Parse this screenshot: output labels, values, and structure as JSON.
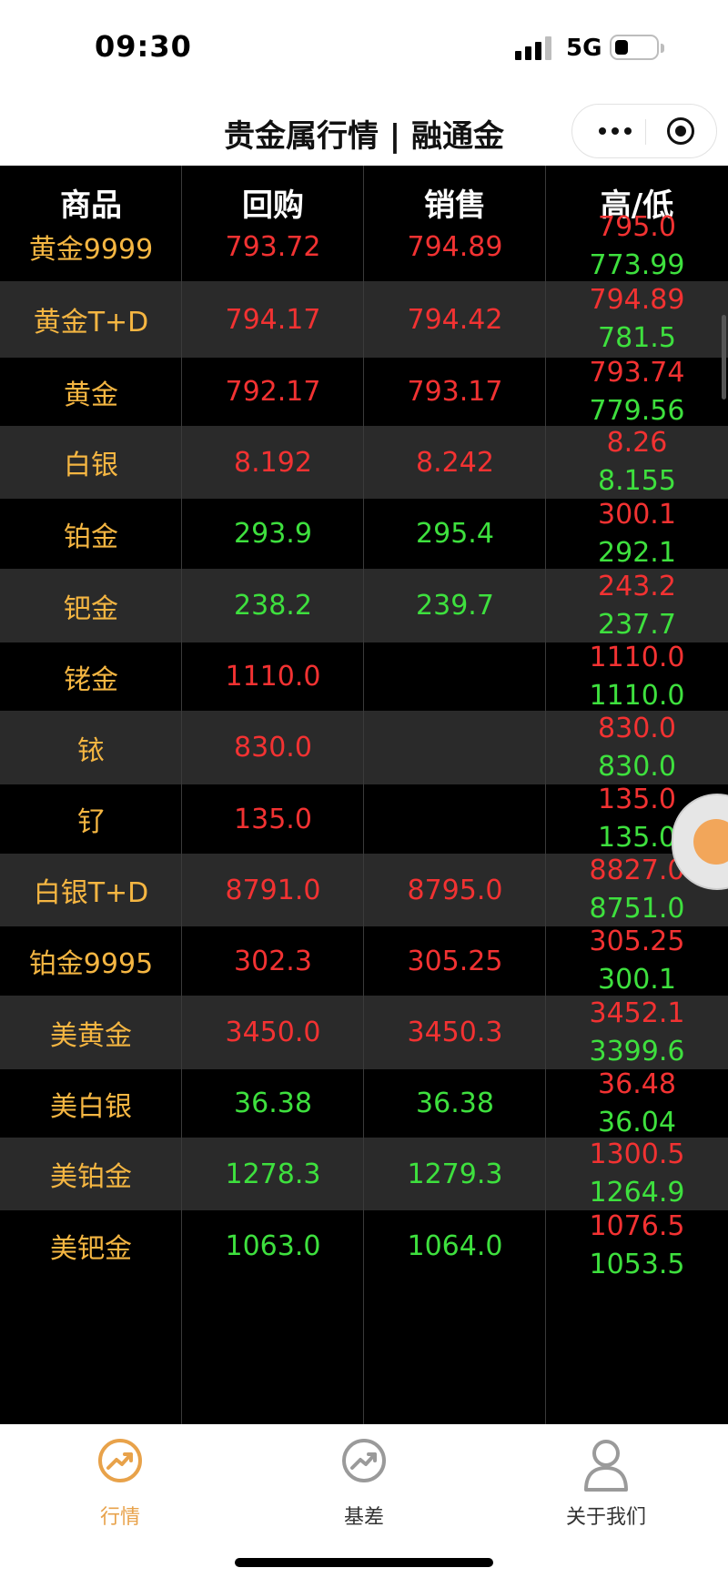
{
  "status_bar": {
    "time": "09:30",
    "network": "5G"
  },
  "nav": {
    "title": "贵金属行情 | 融通金",
    "menu_icon": "more-dots-icon",
    "close_icon": "target-close-icon"
  },
  "table": {
    "headers": [
      "商品",
      "回购",
      "销售",
      "高/低"
    ],
    "rows": [
      {
        "name": "黄金9999",
        "buy": "793.72",
        "buy_color": "red",
        "sell": "794.89",
        "sell_color": "red",
        "high": "795.0",
        "low": "773.99"
      },
      {
        "name": "黄金T+D",
        "buy": "794.17",
        "buy_color": "red",
        "sell": "794.42",
        "sell_color": "red",
        "high": "794.89",
        "low": "781.5"
      },
      {
        "name": "黄金",
        "buy": "792.17",
        "buy_color": "red",
        "sell": "793.17",
        "sell_color": "red",
        "high": "793.74",
        "low": "779.56"
      },
      {
        "name": "白银",
        "buy": "8.192",
        "buy_color": "red",
        "sell": "8.242",
        "sell_color": "red",
        "high": "8.26",
        "low": "8.155"
      },
      {
        "name": "铂金",
        "buy": "293.9",
        "buy_color": "green",
        "sell": "295.4",
        "sell_color": "green",
        "high": "300.1",
        "low": "292.1"
      },
      {
        "name": "钯金",
        "buy": "238.2",
        "buy_color": "green",
        "sell": "239.7",
        "sell_color": "green",
        "high": "243.2",
        "low": "237.7"
      },
      {
        "name": "铑金",
        "buy": "1110.0",
        "buy_color": "red",
        "sell": "",
        "sell_color": "red",
        "high": "1110.0",
        "low": "1110.0"
      },
      {
        "name": "铱",
        "buy": "830.0",
        "buy_color": "red",
        "sell": "",
        "sell_color": "red",
        "high": "830.0",
        "low": "830.0"
      },
      {
        "name": "钌",
        "buy": "135.0",
        "buy_color": "red",
        "sell": "",
        "sell_color": "red",
        "high": "135.0",
        "low": "135.0"
      },
      {
        "name": "白银T+D",
        "buy": "8791.0",
        "buy_color": "red",
        "sell": "8795.0",
        "sell_color": "red",
        "high": "8827.0",
        "low": "8751.0"
      },
      {
        "name": "铂金9995",
        "buy": "302.3",
        "buy_color": "red",
        "sell": "305.25",
        "sell_color": "red",
        "high": "305.25",
        "low": "300.1"
      },
      {
        "name": "美黄金",
        "buy": "3450.0",
        "buy_color": "red",
        "sell": "3450.3",
        "sell_color": "red",
        "high": "3452.1",
        "low": "3399.6"
      },
      {
        "name": "美白银",
        "buy": "36.38",
        "buy_color": "green",
        "sell": "36.38",
        "sell_color": "green",
        "high": "36.48",
        "low": "36.04"
      },
      {
        "name": "美铂金",
        "buy": "1278.3",
        "buy_color": "green",
        "sell": "1279.3",
        "sell_color": "green",
        "high": "1300.5",
        "low": "1264.9"
      },
      {
        "name": "美钯金",
        "buy": "1063.0",
        "buy_color": "green",
        "sell": "1064.0",
        "sell_color": "green",
        "high": "1076.5",
        "low": "1053.5"
      }
    ]
  },
  "tabbar": {
    "tabs": [
      {
        "label": "行情",
        "icon": "trend-chart-icon",
        "active": true
      },
      {
        "label": "基差",
        "icon": "trend-chart-icon",
        "active": false
      },
      {
        "label": "关于我们",
        "icon": "user-icon",
        "active": false
      }
    ]
  },
  "colors": {
    "up": "#f23232",
    "down": "#3ee03e",
    "name": "#f5b642",
    "active_tab": "#e8a24a",
    "inactive_tab": "#333333"
  }
}
